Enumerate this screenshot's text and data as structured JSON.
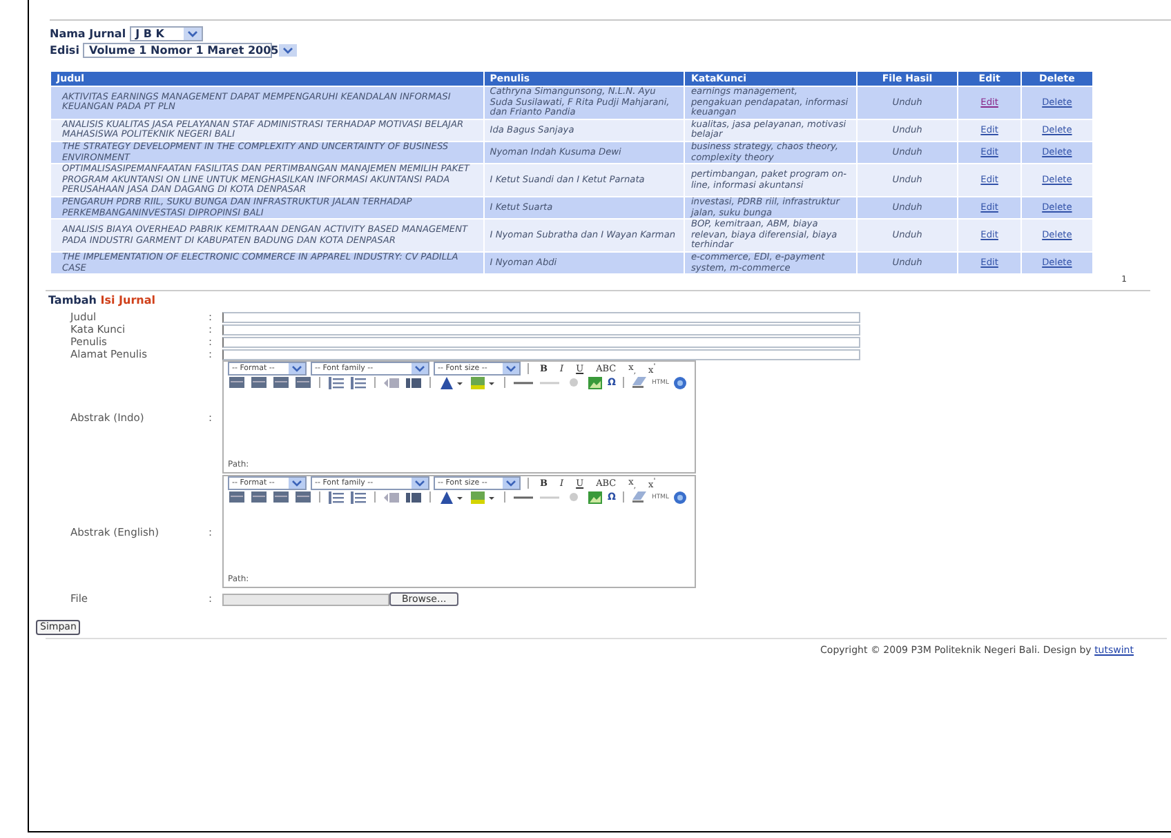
{
  "filters": [
    {
      "label": "Nama Jurnal",
      "value": "J B K"
    },
    {
      "label": "Edisi",
      "value": "Volume 1 Nomor 1 Maret 2005"
    }
  ],
  "table": {
    "columns": [
      "Judul",
      "Penulis",
      "KataKunci",
      "File Hasil",
      "Edit",
      "Delete"
    ],
    "rows": [
      {
        "judul": "AKTIVITAS EARNINGS MANAGEMENT DAPAT MEMPENGARUHI KEANDALAN INFORMASI KEUANGAN PADA PT PLN",
        "penulis": "Cathryna Simangunsong, N.L.N. Ayu Suda Susilawati, F Rita Pudji Mahjarani, dan Frianto Pandia",
        "katakunci": "earnings management, pengakuan pendapatan, informasi keuangan",
        "file": "Unduh",
        "edit": "Edit",
        "edit_visited": true,
        "delete": "Delete"
      },
      {
        "judul": "ANALISIS KUALITAS JASA PELAYANAN STAF ADMINISTRASI TERHADAP MOTIVASI BELAJAR MAHASISWA POLITEKNIK NEGERI BALI",
        "penulis": "Ida Bagus Sanjaya",
        "katakunci": "kualitas, jasa pelayanan, motivasi belajar",
        "file": "Unduh",
        "edit": "Edit",
        "edit_visited": false,
        "delete": "Delete"
      },
      {
        "judul": "THE STRATEGY DEVELOPMENT IN THE COMPLEXITY AND UNCERTAINTY OF BUSINESS ENVIRONMENT",
        "penulis": "Nyoman Indah Kusuma Dewi",
        "katakunci": "business strategy, chaos theory, complexity theory",
        "file": "Unduh",
        "edit": "Edit",
        "edit_visited": false,
        "delete": "Delete"
      },
      {
        "judul": "OPTIMALISASIPEMANFAATAN FASILITAS DAN PERTIMBANGAN MANAJEMEN MEMILIH PAKET PROGRAM AKUNTANSI ON LINE UNTUK MENGHASILKAN INFORMASI AKUNTANSI PADA PERUSAHAAN JASA DAN DAGANG DI KOTA DENPASAR",
        "penulis": "I Ketut Suandi dan I Ketut Parnata",
        "katakunci": "pertimbangan, paket program on-line, informasi akuntansi",
        "file": "Unduh",
        "edit": "Edit",
        "edit_visited": false,
        "delete": "Delete"
      },
      {
        "judul": "PENGARUH PDRB RIIL, SUKU BUNGA DAN INFRASTRUKTUR JALAN TERHADAP PERKEMBANGANINVESTASI DIPROPINSI BALI",
        "penulis": "I Ketut Suarta",
        "katakunci": "investasi, PDRB riil, infrastruktur jalan, suku bunga",
        "file": "Unduh",
        "edit": "Edit",
        "edit_visited": false,
        "delete": "Delete"
      },
      {
        "judul": "ANALISIS BIAYA OVERHEAD PABRIK KEMITRAAN DENGAN ACTIVITY BASED MANAGEMENT PADA INDUSTRI GARMENT DI KABUPATEN BADUNG DAN KOTA DENPASAR",
        "penulis": "I Nyoman Subratha dan I Wayan Karman",
        "katakunci": "BOP, kemitraan, ABM, biaya relevan, biaya diferensial, biaya terhindar",
        "file": "Unduh",
        "edit": "Edit",
        "edit_visited": false,
        "delete": "Delete"
      },
      {
        "judul": "THE IMPLEMENTATION OF ELECTRONIC COMMERCE IN APPAREL INDUSTRY: CV PADILLA CASE",
        "penulis": "I Nyoman Abdi",
        "katakunci": "e-commerce, EDI, e-payment system, m-commerce",
        "file": "Unduh",
        "edit": "Edit",
        "edit_visited": false,
        "delete": "Delete"
      }
    ]
  },
  "pagination": [
    "1"
  ],
  "form": {
    "title_prefix": "Tambah",
    "title_highlight": "Isi Jurnal",
    "fields": [
      {
        "kind": "text",
        "label": "Judul",
        "colon": ":"
      },
      {
        "kind": "text",
        "label": "Kata Kunci",
        "colon": ":"
      },
      {
        "kind": "text",
        "label": "Penulis",
        "colon": ":"
      },
      {
        "kind": "text",
        "label": "Alamat Penulis",
        "colon": ":"
      },
      {
        "kind": "editor",
        "label": "Abstrak (Indo)",
        "colon": ":",
        "selects": [
          "-- Format --",
          "-- Font family --",
          "-- Font size --"
        ],
        "format_buttons": [
          "B",
          "I",
          "U",
          "ABC",
          "x$_{,}$",
          "x$^{'}$"
        ],
        "special_char": "Ω",
        "html_button": "HTML",
        "path_label": "Path:"
      },
      {
        "kind": "editor",
        "label": "Abstrak (English)",
        "colon": ":",
        "selects": [
          "-- Format --",
          "-- Font family --",
          "-- Font size --"
        ],
        "format_buttons": [
          "B",
          "I",
          "U",
          "ABC",
          "x$_{,}$",
          "x$^{'}$"
        ],
        "special_char": "Ω",
        "html_button": "HTML",
        "path_label": "Path:"
      },
      {
        "kind": "file",
        "label": "File",
        "colon": ":",
        "button": "Browse..."
      }
    ],
    "submit": "Simpan"
  },
  "footer": {
    "text": "Copyright © 2009 P3M Politeknik Negeri Bali. Design by",
    "link": "tutswint"
  }
}
